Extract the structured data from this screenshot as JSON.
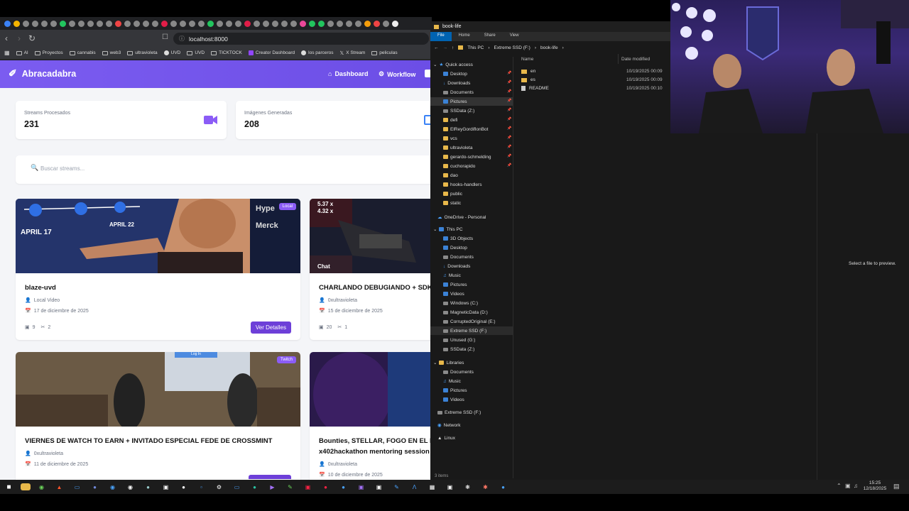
{
  "browser": {
    "url": "localhost:8000",
    "bookmarks": [
      "AI",
      "Proyectos",
      "cannabis",
      "web3",
      "ultravioleta",
      "UVD",
      "UVD",
      "TICKTOCK",
      "Creator Dashboard",
      "los parceros",
      "X Stream",
      "peliculas"
    ]
  },
  "app": {
    "brand": "Abracadabra",
    "nav": [
      "Dashboard",
      "Workflow"
    ],
    "stats": [
      {
        "label": "Streams Procesados",
        "value": "231"
      },
      {
        "label": "Imágenes Generadas",
        "value": "208"
      }
    ],
    "search_placeholder": "Buscar streams...",
    "cards": [
      {
        "title": "blaze-uvd",
        "author": "Local Video",
        "date": "17 de diciembre de 2025",
        "images": "9",
        "clips": "2",
        "badge": "Local",
        "button": "Ver Detalles",
        "img_text": [
          "APRIL 17",
          "APRIL 22",
          "Hype",
          "Merck"
        ]
      },
      {
        "title": "CHARLANDO DEBUGIANDO + SDK",
        "author": "0xultravioleta",
        "date": "15 de diciembre de 2025",
        "images": "20",
        "clips": "1",
        "img_text": [
          "5.37 x",
          "4.32 x",
          "Chat"
        ]
      },
      {
        "title": "VIERNES DE WATCH TO EARN + INVITADO ESPECIAL FEDE DE CROSSMINT",
        "author": "0xultravioleta",
        "date": "11 de diciembre de 2025",
        "badge": "Twitch",
        "img_text": [
          "Log In"
        ]
      },
      {
        "title": "Bounties, STELLAR, FOGO EN EL FA",
        "title2": "x402hackathon mentoring session",
        "author": "0xultravioleta",
        "date": "10 de diciembre de 2025"
      }
    ]
  },
  "explorer": {
    "window_title": "book-life",
    "ribbon": [
      "File",
      "Home",
      "Share",
      "View"
    ],
    "breadcrumb": [
      "This PC",
      "Extreme SSD (F:)",
      "book-life"
    ],
    "quick_access": "Quick access",
    "quick_items": [
      "Desktop",
      "Downloads",
      "Documents",
      "Pictures",
      "SSData (Z:)",
      "defi",
      "ElReyGordiflonBot",
      "vcs",
      "ultravioleta",
      "gerardo-schmelding",
      "cuchorapido",
      "dao",
      "hooks-handlers",
      "public",
      "static"
    ],
    "onedrive": "OneDrive - Personal",
    "this_pc": "This PC",
    "pc_items": [
      "3D Objects",
      "Desktop",
      "Documents",
      "Downloads",
      "Music",
      "Pictures",
      "Videos",
      "Windows (C:)",
      "MagneticData (D:)",
      "CorruptedOriginal (E:)",
      "Extreme SSD (F:)",
      "Unused (G:)",
      "SSData (Z:)"
    ],
    "libraries": "Libraries",
    "lib_items": [
      "Documents",
      "Music",
      "Pictures",
      "Videos"
    ],
    "extreme": "Extreme SSD (F:)",
    "network": "Network",
    "linux": "Linux",
    "col_name": "Name",
    "col_date": "Date modified",
    "files": [
      {
        "name": "en",
        "date": "10/19/2025 00:09"
      },
      {
        "name": "es",
        "date": "10/19/2025 00:09"
      },
      {
        "name": "README",
        "date": "10/19/2025 00:10"
      }
    ],
    "status": "3 items",
    "preview": "Select a file to preview."
  },
  "taskbar": {
    "time": "15:25",
    "date": "12/18/2025"
  }
}
